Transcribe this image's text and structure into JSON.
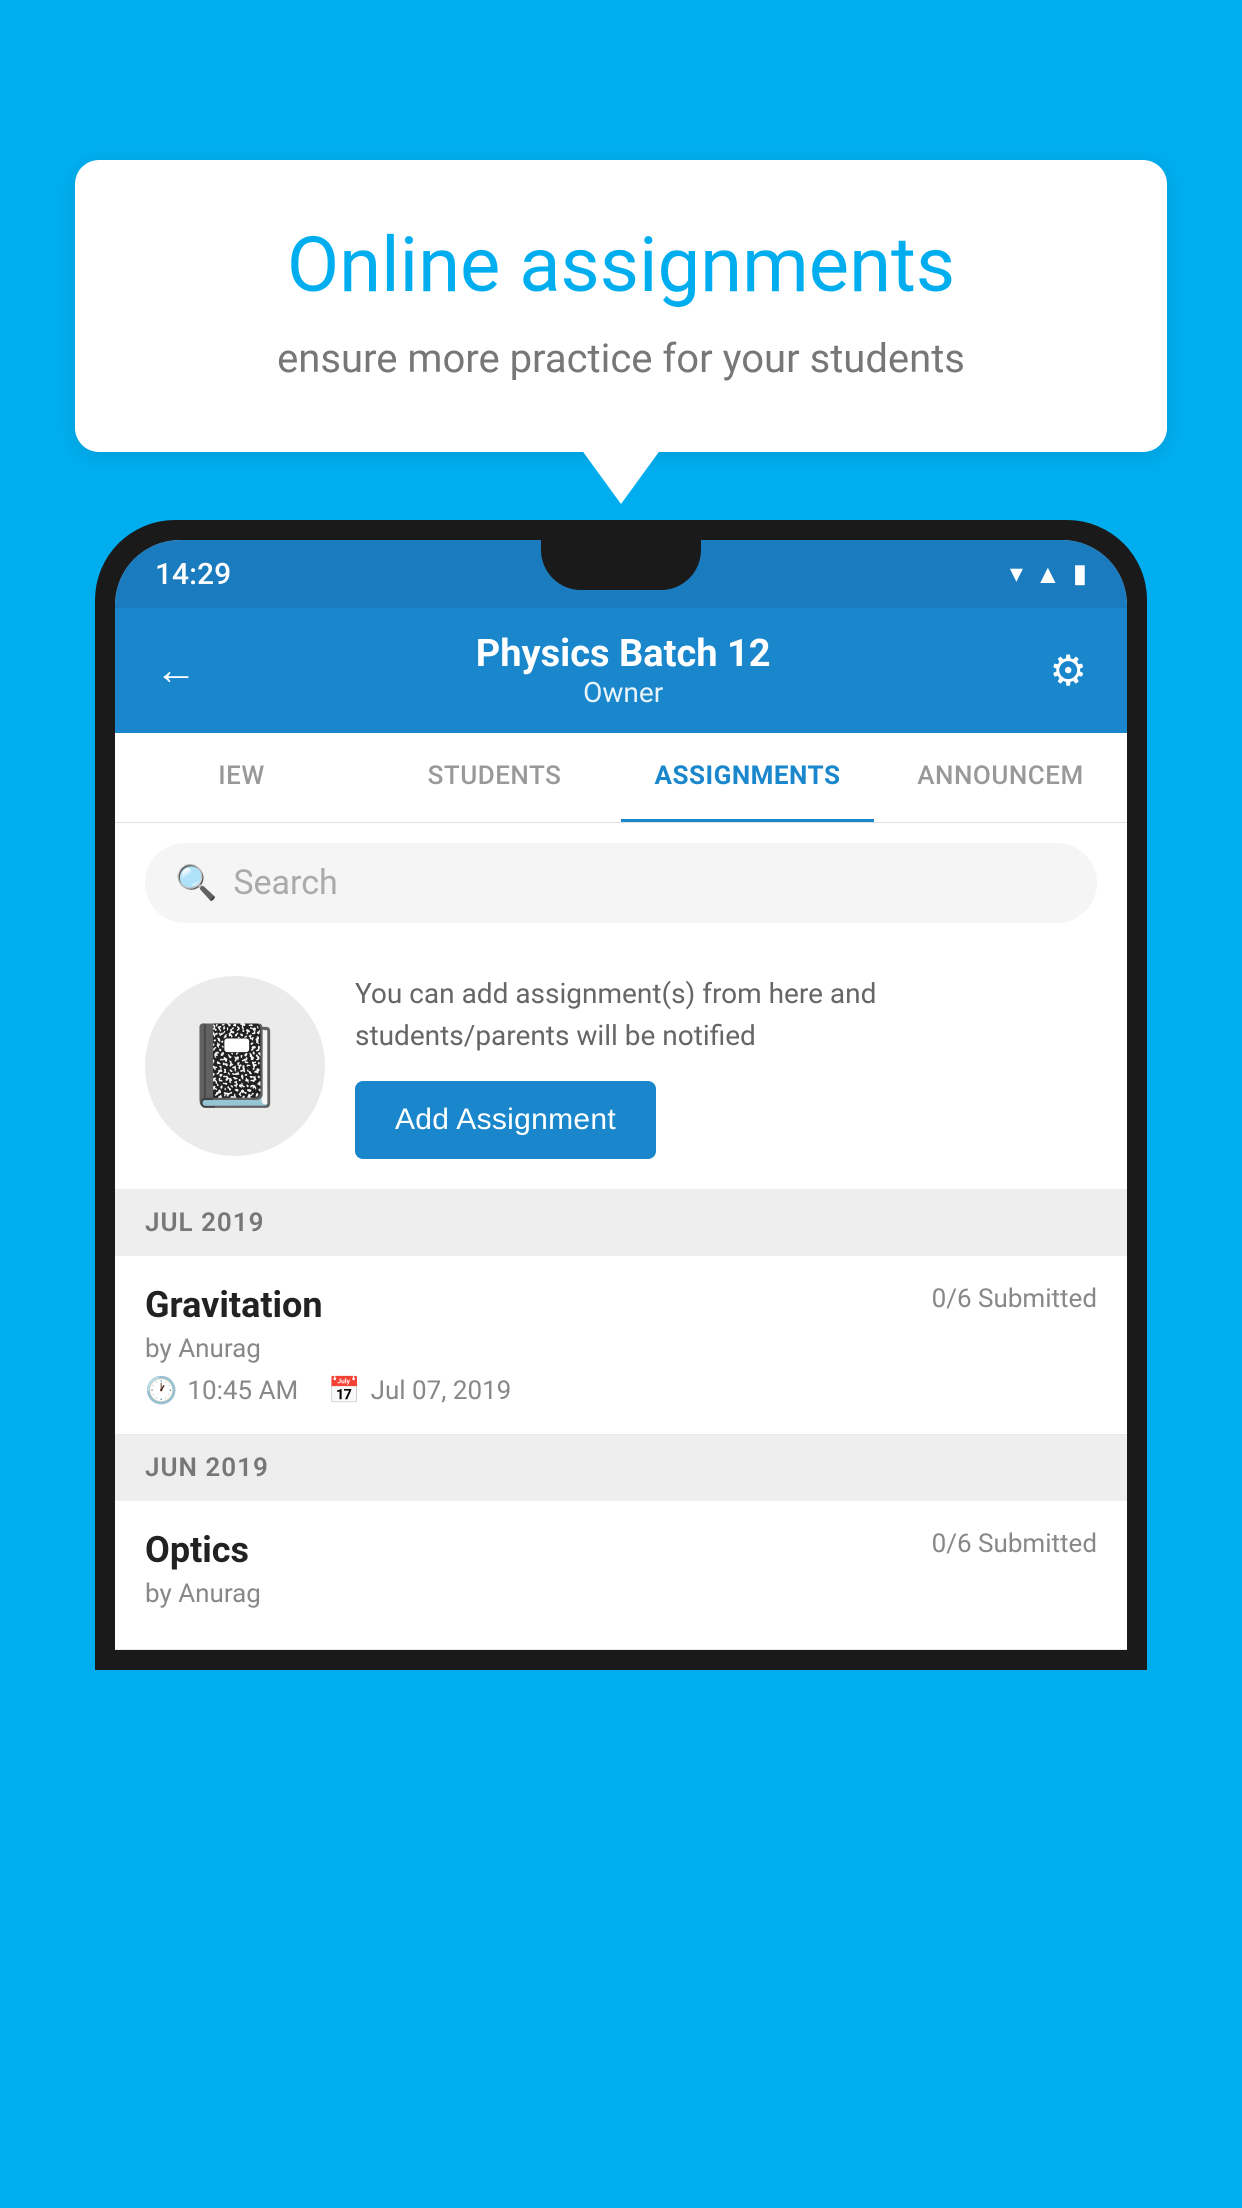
{
  "background_color": "#00AEEF",
  "speech_bubble": {
    "title": "Online assignments",
    "subtitle": "ensure more practice for your students"
  },
  "status_bar": {
    "time": "14:29",
    "icons": [
      "wifi",
      "signal",
      "battery"
    ]
  },
  "app_header": {
    "title": "Physics Batch 12",
    "subtitle": "Owner",
    "back_label": "←",
    "settings_label": "⚙"
  },
  "tabs": [
    {
      "label": "IEW",
      "active": false
    },
    {
      "label": "STUDENTS",
      "active": false
    },
    {
      "label": "ASSIGNMENTS",
      "active": true
    },
    {
      "label": "ANNOUNCEM",
      "active": false
    }
  ],
  "search": {
    "placeholder": "Search"
  },
  "promo": {
    "text": "You can add assignment(s) from here and students/parents will be notified",
    "button_label": "Add Assignment"
  },
  "sections": [
    {
      "month_label": "JUL 2019",
      "assignments": [
        {
          "name": "Gravitation",
          "submitted": "0/6 Submitted",
          "by": "by Anurag",
          "time": "10:45 AM",
          "date": "Jul 07, 2019"
        }
      ]
    },
    {
      "month_label": "JUN 2019",
      "assignments": [
        {
          "name": "Optics",
          "submitted": "0/6 Submitted",
          "by": "by Anurag",
          "time": "",
          "date": ""
        }
      ]
    }
  ]
}
